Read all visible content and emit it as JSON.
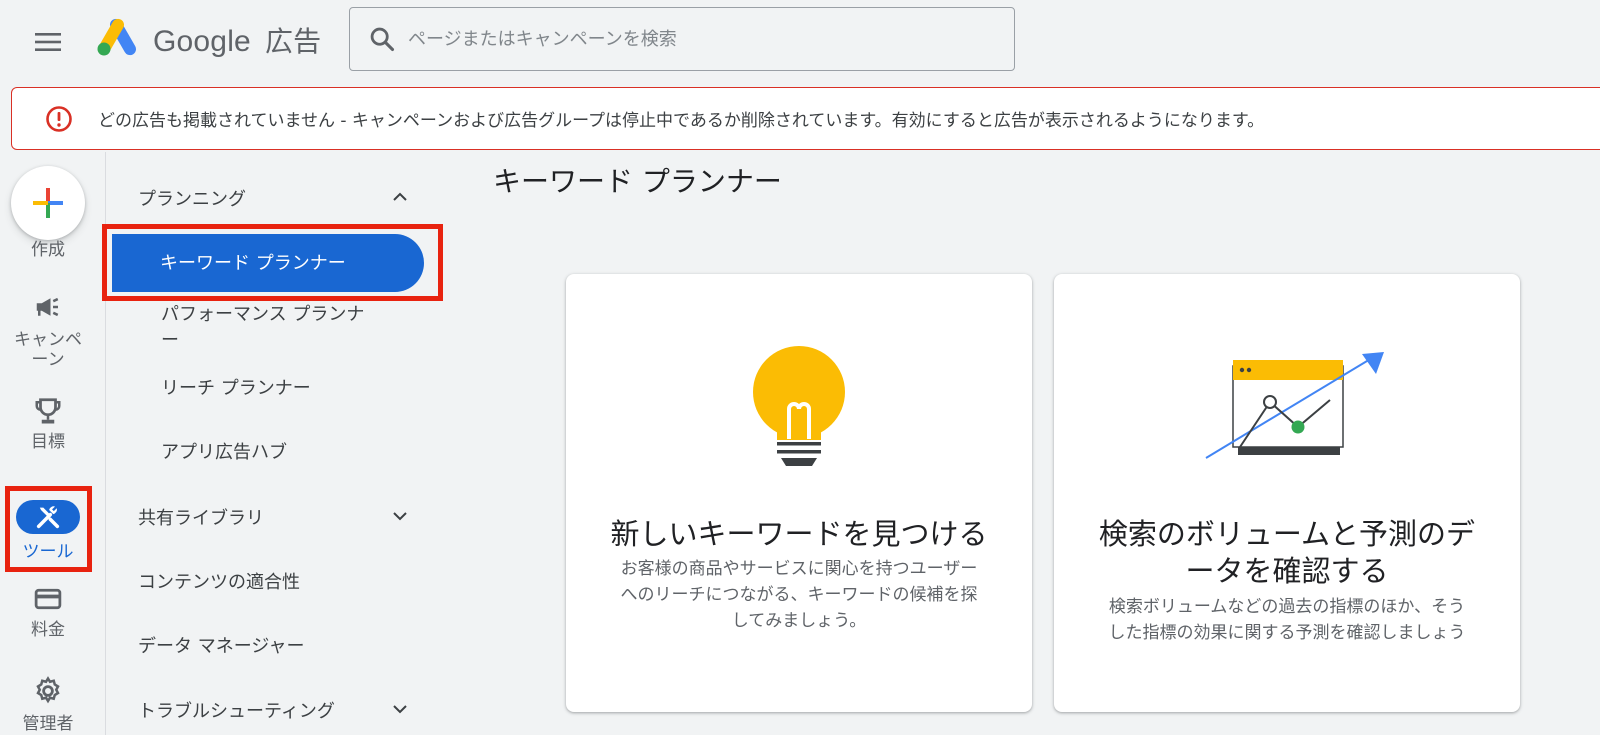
{
  "header": {
    "brand_name": "Google",
    "brand_suffix": "広告",
    "search_placeholder": "ページまたはキャンペーンを検索",
    "menu_icon": "hamburger-menu-icon",
    "search_icon": "search-icon"
  },
  "alert": {
    "icon": "error-icon",
    "text": "どの広告も掲載されていません - キャンペーンおよび広告グループは停止中であるか削除されています。有効にすると広告が表示されるようになります。",
    "color": "#d93025"
  },
  "rail": {
    "create_label": "作成",
    "items": [
      {
        "label1": "キャンペ",
        "label2": "ーン",
        "icon": "megaphone-icon"
      },
      {
        "label": "目標",
        "icon": "trophy-icon"
      },
      {
        "label": "ツール",
        "icon": "tools-icon",
        "active": true
      },
      {
        "label": "料金",
        "icon": "credit-card-icon"
      },
      {
        "label": "管理者",
        "icon": "gear-icon"
      }
    ]
  },
  "subnav": {
    "planning": "プランニング",
    "keyword_planner": "キーワード プランナー",
    "performance_planner_1": "パフォーマンス プランナ",
    "performance_planner_2": "ー",
    "reach_planner": "リーチ プランナー",
    "app_ads_hub": "アプリ広告ハブ",
    "shared_library": "共有ライブラリ",
    "content_suitability": "コンテンツの適合性",
    "data_manager": "データ マネージャー",
    "troubleshooting": "トラブルシューティング"
  },
  "main": {
    "title": "キーワード プランナー",
    "cards": [
      {
        "title": "新しいキーワードを見つける",
        "desc1": "お客様の商品やサービスに関心を持つユーザー",
        "desc2": "へのリーチにつながる、キーワードの候補を探",
        "desc3": "してみましょう。",
        "icon": "lightbulb-icon"
      },
      {
        "title1": "検索のボリュームと予測のデ",
        "title2": "ータを確認する",
        "desc1": "検索ボリュームなどの過去の指標のほか、そう",
        "desc2": "した指標の効果に関する予測を確認しましょう",
        "icon": "trend-chart-icon"
      }
    ]
  },
  "colors": {
    "accent": "#1967d2",
    "highlight": "#e8220f",
    "alert": "#d93025"
  }
}
